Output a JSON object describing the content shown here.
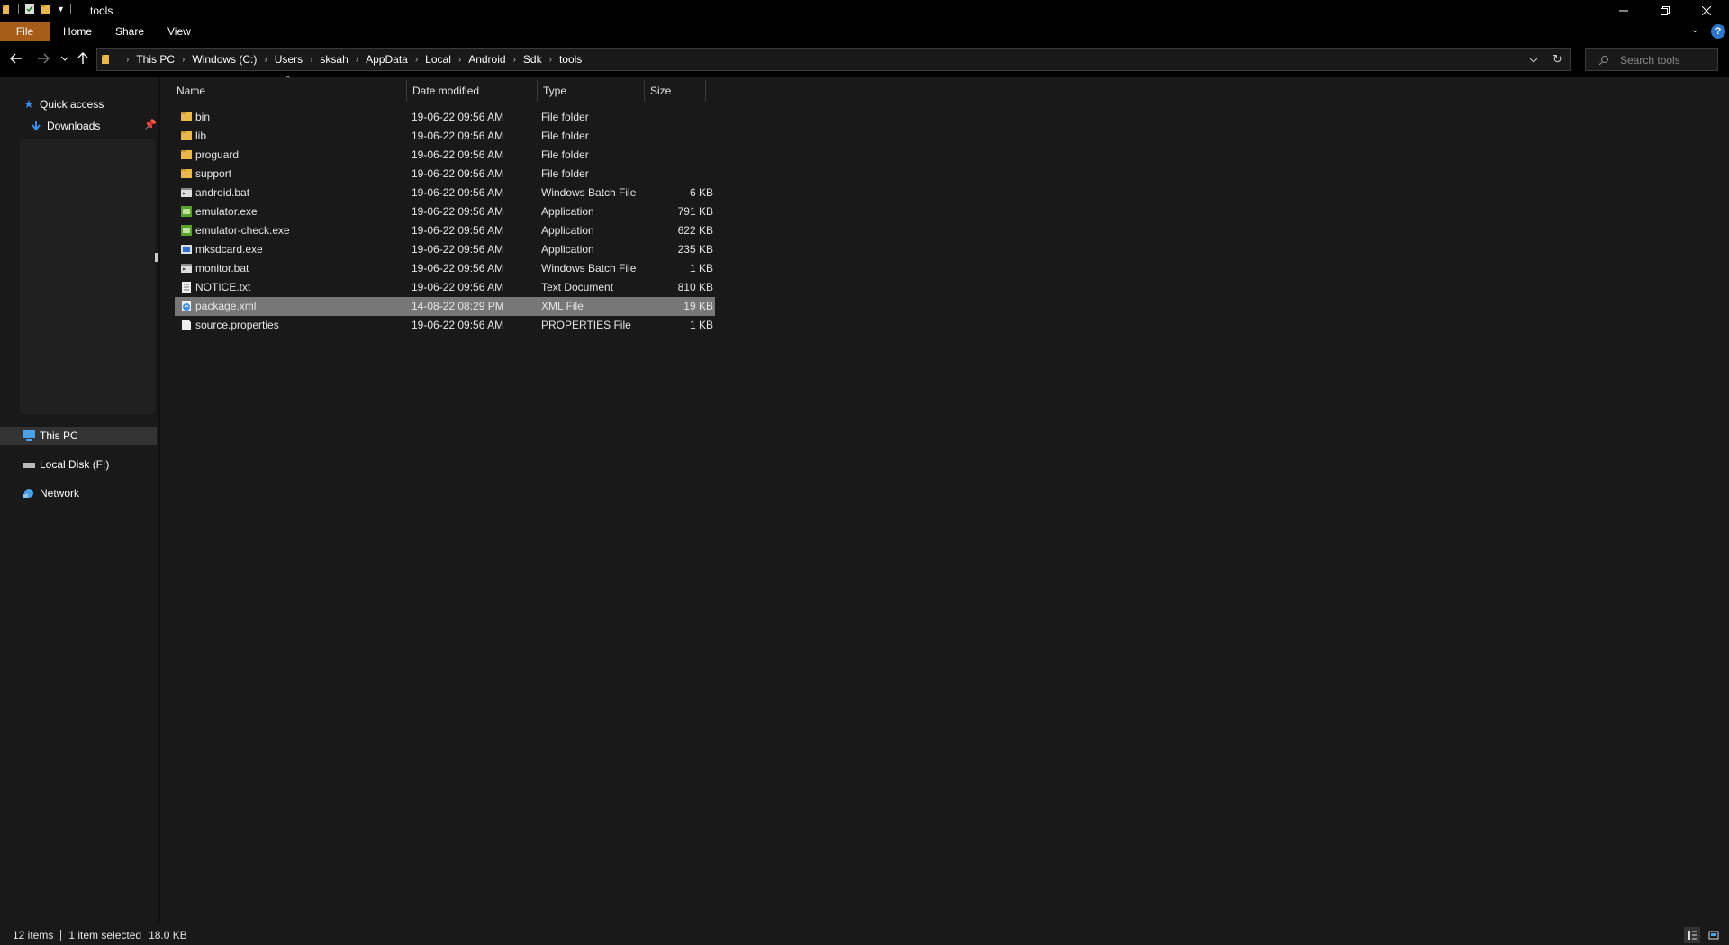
{
  "window": {
    "title": "tools"
  },
  "ribbon": {
    "tabs": [
      "File",
      "Home",
      "Share",
      "View"
    ]
  },
  "address": {
    "crumbs": [
      "This PC",
      "Windows (C:)",
      "Users",
      "sksah",
      "AppData",
      "Local",
      "Android",
      "Sdk",
      "tools"
    ]
  },
  "search": {
    "placeholder": "Search tools"
  },
  "sidebar": {
    "quick_access": "Quick access",
    "downloads": "Downloads",
    "this_pc": "This PC",
    "local_disk": "Local Disk (F:)",
    "network": "Network"
  },
  "columns": {
    "name": "Name",
    "date": "Date modified",
    "type": "Type",
    "size": "Size"
  },
  "files": [
    {
      "name": "bin",
      "date": "19-06-22 09:56 AM",
      "type": "File folder",
      "size": "",
      "icon": "folder-icon"
    },
    {
      "name": "lib",
      "date": "19-06-22 09:56 AM",
      "type": "File folder",
      "size": "",
      "icon": "folder-icon"
    },
    {
      "name": "proguard",
      "date": "19-06-22 09:56 AM",
      "type": "File folder",
      "size": "",
      "icon": "folder-icon"
    },
    {
      "name": "support",
      "date": "19-06-22 09:56 AM",
      "type": "File folder",
      "size": "",
      "icon": "folder-icon"
    },
    {
      "name": "android.bat",
      "date": "19-06-22 09:56 AM",
      "type": "Windows Batch File",
      "size": "6 KB",
      "icon": "batch-file-icon"
    },
    {
      "name": "emulator.exe",
      "date": "19-06-22 09:56 AM",
      "type": "Application",
      "size": "791 KB",
      "icon": "application-icon"
    },
    {
      "name": "emulator-check.exe",
      "date": "19-06-22 09:56 AM",
      "type": "Application",
      "size": "622 KB",
      "icon": "application-icon"
    },
    {
      "name": "mksdcard.exe",
      "date": "19-06-22 09:56 AM",
      "type": "Application",
      "size": "235 KB",
      "icon": "application-blue-icon"
    },
    {
      "name": "monitor.bat",
      "date": "19-06-22 09:56 AM",
      "type": "Windows Batch File",
      "size": "1 KB",
      "icon": "batch-file-icon"
    },
    {
      "name": "NOTICE.txt",
      "date": "19-06-22 09:56 AM",
      "type": "Text Document",
      "size": "810 KB",
      "icon": "text-file-icon"
    },
    {
      "name": "package.xml",
      "date": "14-08-22 08:29 PM",
      "type": "XML File",
      "size": "19 KB",
      "icon": "xml-file-icon",
      "selected": true
    },
    {
      "name": "source.properties",
      "date": "19-06-22 09:56 AM",
      "type": "PROPERTIES File",
      "size": "1 KB",
      "icon": "blank-file-icon"
    }
  ],
  "status": {
    "items": "12 items",
    "selected": "1 item selected",
    "size": "18.0 KB"
  },
  "colors": {
    "accent_file_tab": "#a75c17",
    "selection": "#777777",
    "folder": "#e8b84a"
  }
}
